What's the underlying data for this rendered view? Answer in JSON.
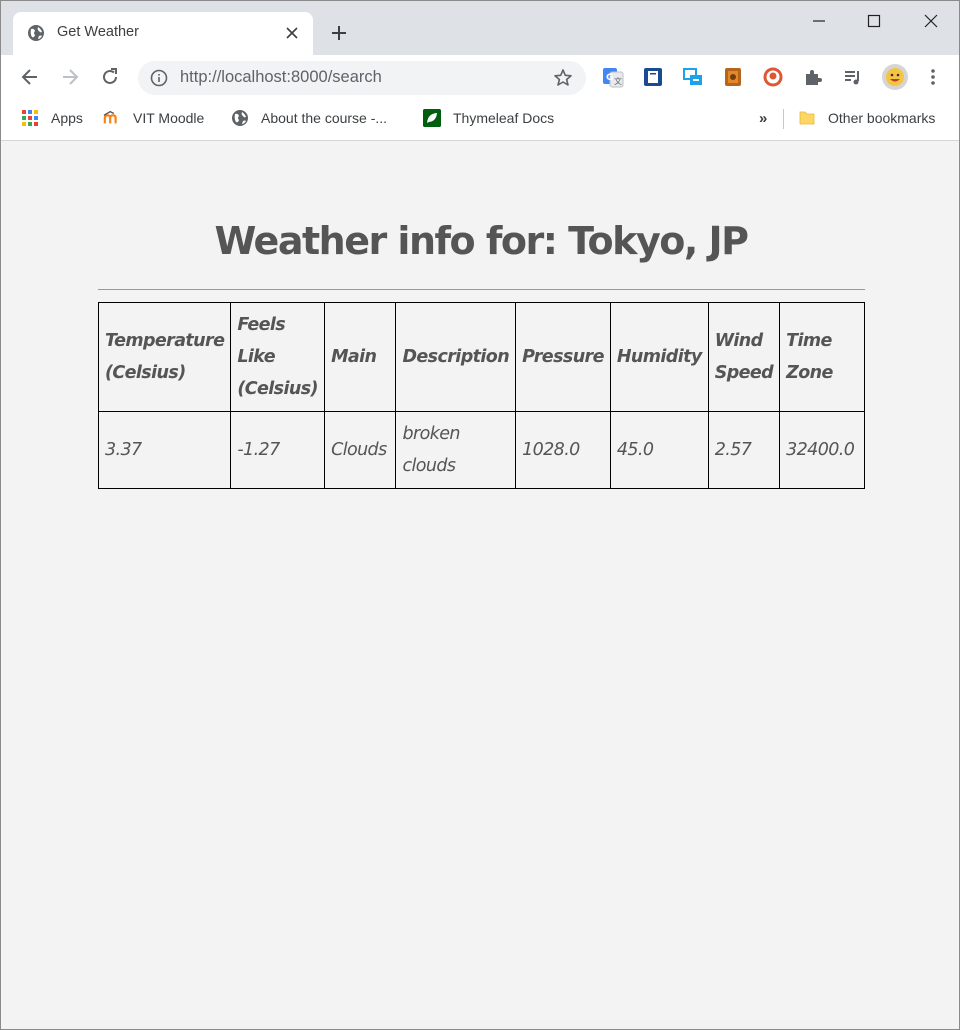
{
  "browser": {
    "tab": {
      "title": "Get Weather",
      "favicon": "globe-icon"
    },
    "address_bar": {
      "url_host": "http://localhost",
      "url_rest": ":8000/search"
    },
    "bookmarks": [
      {
        "label": "Apps",
        "icon": "apps-grid-icon"
      },
      {
        "label": "VIT Moodle",
        "icon": "moodle-icon"
      },
      {
        "label": "About the course -...",
        "icon": "globe-icon"
      },
      {
        "label": "Thymeleaf Docs",
        "icon": "thymeleaf-icon"
      }
    ],
    "bookmarks_overflow": "»",
    "other_bookmarks": "Other bookmarks"
  },
  "page": {
    "heading": "Weather info for: Tokyo, JP",
    "table": {
      "headers": [
        [
          "Temperature",
          "(Celsius)"
        ],
        [
          "Feels",
          "Like",
          "(Celsius)"
        ],
        [
          "Main"
        ],
        [
          "Description"
        ],
        [
          "Pressure"
        ],
        [
          "Humidity"
        ],
        [
          "Wind",
          "Speed"
        ],
        [
          "Time",
          "Zone"
        ]
      ],
      "row": [
        [
          "3.37"
        ],
        [
          "-1.27"
        ],
        [
          "Clouds"
        ],
        [
          "broken",
          "clouds"
        ],
        [
          "1028.0"
        ],
        [
          "45.0"
        ],
        [
          "2.57"
        ],
        [
          "32400.0"
        ]
      ]
    }
  }
}
